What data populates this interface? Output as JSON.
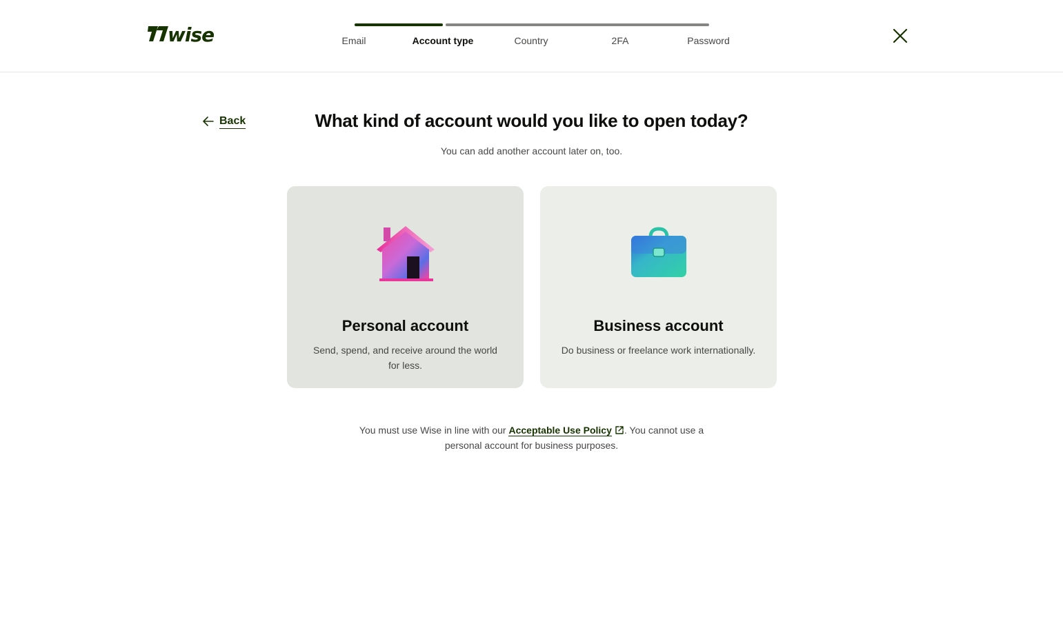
{
  "header": {
    "logo_text": "7WISE",
    "steps": [
      {
        "label": "Email",
        "state": "done"
      },
      {
        "label": "Account type",
        "state": "current"
      },
      {
        "label": "Country",
        "state": "todo"
      },
      {
        "label": "2FA",
        "state": "todo"
      },
      {
        "label": "Password",
        "state": "todo"
      }
    ],
    "progress_completed_steps": 2,
    "close_icon": "close-icon"
  },
  "main": {
    "back_label": "Back",
    "title": "What kind of account would you like to open today?",
    "subtitle": "You can add another account later on, too.",
    "cards": [
      {
        "title": "Personal account",
        "description": "Send, spend, and receive around the world for less.",
        "icon": "house-icon",
        "selected": true
      },
      {
        "title": "Business account",
        "description": "Do business or freelance work internationally.",
        "icon": "briefcase-icon",
        "selected": false
      }
    ],
    "footer": {
      "prefix": "You must use Wise in line with our ",
      "link_label": "Acceptable Use Policy",
      "suffix": ". You cannot use a personal account for business purposes."
    }
  },
  "colors": {
    "brand": "#163300",
    "text": "#0e0f0c",
    "muted": "#454745",
    "card_bg": "#eceeea",
    "card_selected_bg": "#e2e4df"
  }
}
